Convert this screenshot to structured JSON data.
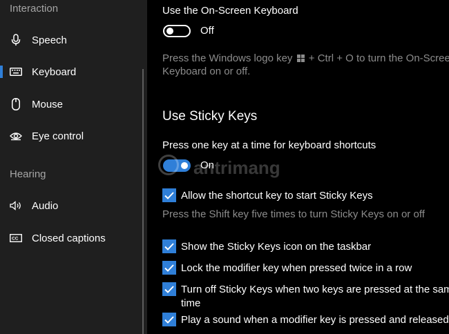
{
  "sidebar": {
    "group_interaction": "Interaction",
    "group_hearing": "Hearing",
    "items": [
      {
        "label": "Speech",
        "icon": "microphone-icon"
      },
      {
        "label": "Keyboard",
        "icon": "keyboard-icon",
        "selected": true
      },
      {
        "label": "Mouse",
        "icon": "mouse-icon"
      },
      {
        "label": "Eye control",
        "icon": "eye-control-icon"
      },
      {
        "label": "Audio",
        "icon": "speaker-icon"
      },
      {
        "label": "Closed captions",
        "icon": "closed-captions-icon"
      }
    ]
  },
  "onscreen_keyboard": {
    "label": "Use the On-Screen Keyboard",
    "toggle_state": "Off",
    "hint_line1_a": "Press the Windows logo key",
    "hint_line1_b": "+ Ctrl + O to turn the On-Screen",
    "hint_line2": "Keyboard on or off.",
    "toggle_on": false
  },
  "sticky_keys": {
    "heading": "Use Sticky Keys",
    "label": "Press one key at a time for keyboard shortcuts",
    "toggle_state": "On",
    "toggle_on": true,
    "options": [
      {
        "label": "Allow the shortcut key to start Sticky Keys",
        "checked": true
      },
      {
        "label": "Show the Sticky Keys icon on the taskbar",
        "checked": true
      },
      {
        "label": "Lock the modifier key when pressed twice in a row",
        "checked": true
      },
      {
        "label": "Turn off Sticky Keys when two keys are pressed at the same",
        "label_line2": "time",
        "checked": true
      },
      {
        "label": "Play a sound when a modifier key is pressed and released",
        "checked": true
      }
    ],
    "shortcut_hint": "Press the Shift key five times to turn Sticky Keys on or off"
  },
  "watermark": "antrimang",
  "colors": {
    "accent": "#2f7fd8",
    "sidebar_bg": "#1f1f1f",
    "main_bg": "#000000",
    "muted_text": "#8c8c8c"
  }
}
